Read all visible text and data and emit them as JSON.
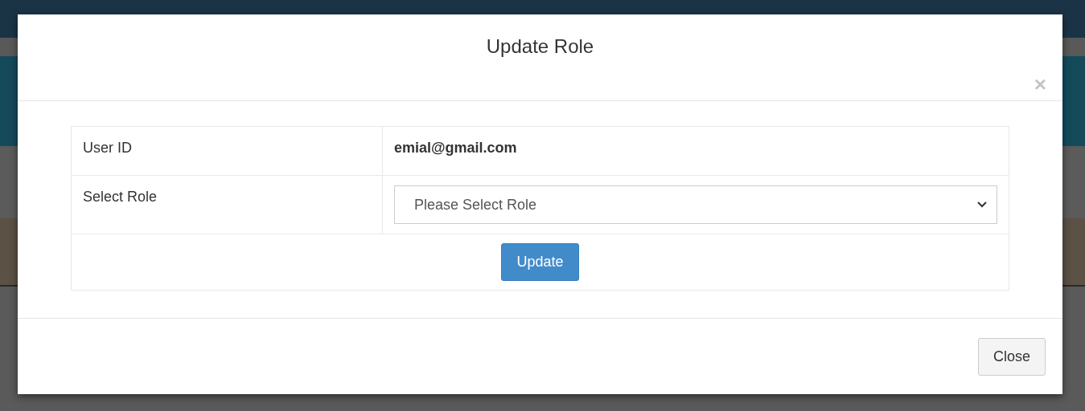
{
  "modal": {
    "title": "Update Role",
    "close_icon": "×",
    "rows": [
      {
        "kind": "text",
        "label": "User ID",
        "value": "emial@gmail.com"
      },
      {
        "kind": "select",
        "label": "Select Role",
        "placeholder": "Please Select Role"
      }
    ],
    "submit": "Update",
    "footer_button": "Close"
  }
}
